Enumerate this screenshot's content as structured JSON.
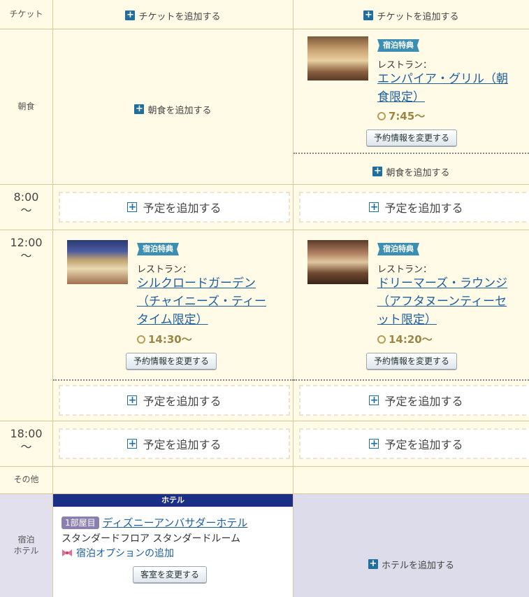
{
  "rows": {
    "ticket": {
      "label": "チケット",
      "add1": "チケットを追加する",
      "add2": "チケットを追加する"
    },
    "breakfast": {
      "label": "朝食",
      "add1": "朝食を追加する",
      "add2": "朝食を追加する"
    },
    "t800": {
      "label_time": "8:00",
      "label_tilde": "〜"
    },
    "t1200": {
      "label_time": "12:00",
      "label_tilde": "〜"
    },
    "t1800": {
      "label_time": "18:00",
      "label_tilde": "〜"
    },
    "other": {
      "label": "その他"
    },
    "hotel": {
      "label1": "宿泊",
      "label2": "ホテル",
      "add2": "ホテルを追加する"
    }
  },
  "slot_label": "予定を追加する",
  "bf_card": {
    "badge": "宿泊特典",
    "type": "レストラン：",
    "name_line1": "エンパイア・グリル（朝",
    "name_line2": "食限定）",
    "time": "7:45〜",
    "button": "予約情報を変更する"
  },
  "lunch_card1": {
    "badge": "宿泊特典",
    "type": "レストラン：",
    "name_line1": "シルクロードガーデン",
    "name_line2": "（チャイニーズ・ティー",
    "name_line3": "タイム限定）",
    "time": "14:30〜",
    "button": "予約情報を変更する"
  },
  "lunch_card2": {
    "badge": "宿泊特典",
    "type": "レストラン：",
    "name_line1": "ドリーマーズ・ラウンジ",
    "name_line2": "（アフタヌーンティーセ",
    "name_line3": "ット限定）",
    "time": "14:20〜",
    "button": "予約情報を変更する"
  },
  "hotel_card": {
    "bar": "ホテル",
    "room_tag": "1部屋目",
    "name": "ディズニーアンバサダーホテル",
    "room_type": "スタンダードフロア スタンダードルーム",
    "option": "宿泊オプションの追加",
    "button": "客室を変更する"
  },
  "colors": {
    "accent": "#1e6fa0",
    "link": "#1e5fa0",
    "hotel_bar": "#1c2f86",
    "background": "#fffbe6"
  }
}
